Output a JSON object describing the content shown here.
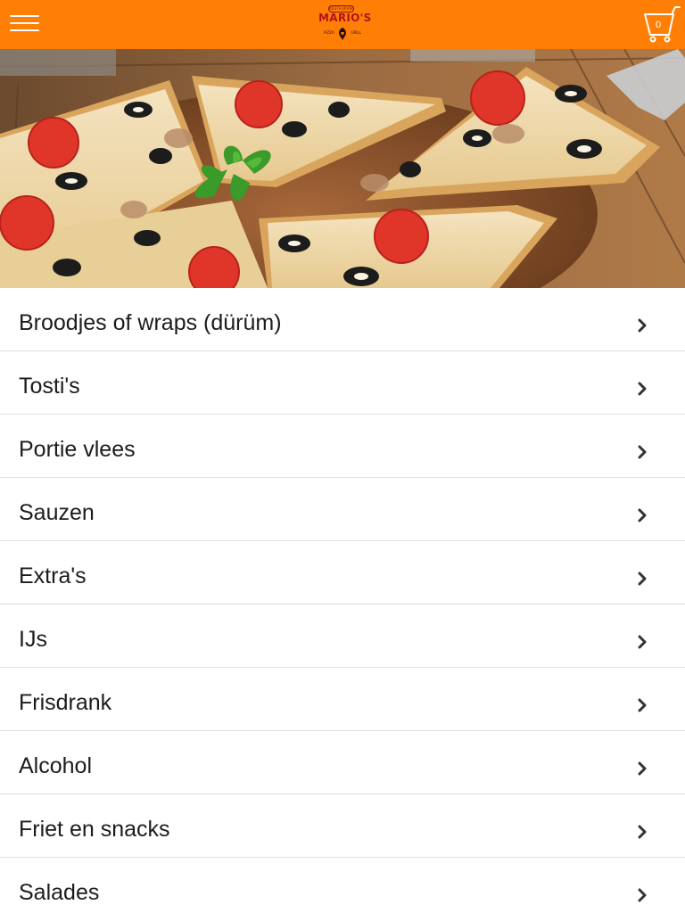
{
  "header": {
    "brand": {
      "tagline": "RESTAURANT",
      "name": "MARIO'S",
      "left_word": "PIZZA",
      "right_word": "GRILL"
    },
    "menu_icon": "hamburger-menu-icon",
    "cart_icon": "shopping-cart-icon",
    "cart_count": "0"
  },
  "hero": {
    "image": "pizza-slices-on-wooden-board"
  },
  "categories": [
    {
      "label": "Broodjes of wraps (dürüm)"
    },
    {
      "label": "Tosti's"
    },
    {
      "label": "Portie vlees"
    },
    {
      "label": "Sauzen"
    },
    {
      "label": "Extra's"
    },
    {
      "label": "IJs"
    },
    {
      "label": "Frisdrank"
    },
    {
      "label": "Alcohol"
    },
    {
      "label": "Friet en snacks"
    },
    {
      "label": "Salades"
    }
  ],
  "colors": {
    "header_bg": "#ff7f06",
    "brand_red": "#b3121a",
    "text": "#1c1c1c",
    "divider": "#e0e0e0"
  }
}
